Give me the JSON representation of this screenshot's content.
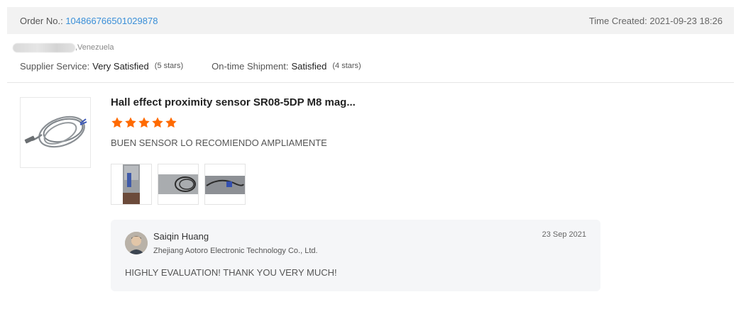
{
  "order": {
    "label": "Order No.:",
    "number": "104866766501029878",
    "time_created_label": "Time Created:",
    "time_created": "2021-09-23 18:26"
  },
  "buyer": {
    "country": ",Venezuela"
  },
  "ratings": {
    "supplier_service_label": "Supplier Service:",
    "supplier_service_value": "Very Satisfied",
    "supplier_service_stars": "(5 stars)",
    "shipment_label": "On-time Shipment:",
    "shipment_value": "Satisfied",
    "shipment_stars": "(4 stars)"
  },
  "review": {
    "product_title": "Hall effect proximity sensor SR08-5DP M8 mag...",
    "star_rating": 5,
    "star_color": "#ff6a00",
    "text": "BUEN SENSOR LO RECOMIENDO AMPLIAMENTE",
    "photo_count": 3
  },
  "reply": {
    "seller_name": "Saiqin Huang",
    "company": "Zhejiang Aotoro Electronic Technology Co., Ltd.",
    "date": "23 Sep 2021",
    "text": "HIGHLY EVALUATION! THANK YOU VERY MUCH!"
  },
  "colors": {
    "link": "#3a8fd8",
    "header_bg": "#f2f2f2",
    "reply_bg": "#f5f6f8"
  }
}
